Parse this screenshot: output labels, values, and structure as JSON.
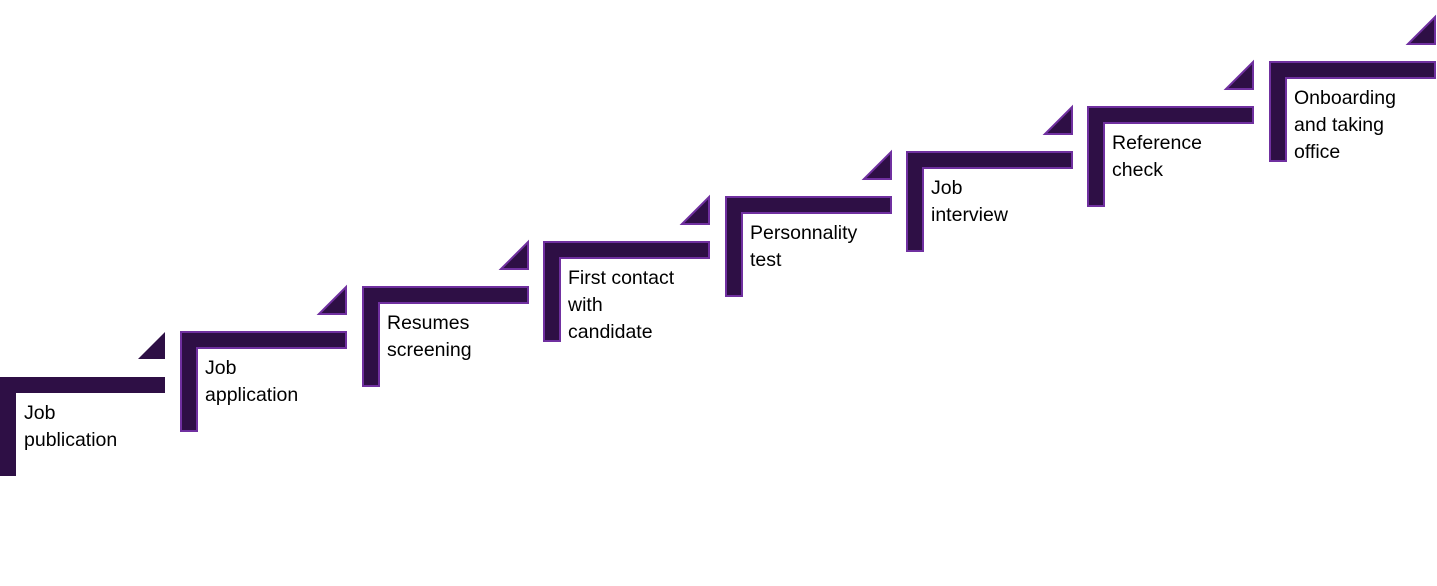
{
  "colors": {
    "fill": "#2e0f45",
    "outline": "#7030a0",
    "text": "#000000"
  },
  "steps": [
    {
      "label": "Job\npublication"
    },
    {
      "label": "Job\napplication"
    },
    {
      "label": "Resumes\nscreening"
    },
    {
      "label": "First contact\nwith\ncandidate"
    },
    {
      "label": "Personnality\ntest"
    },
    {
      "label": "Job\ninterview"
    },
    {
      "label": "Reference\ncheck"
    },
    {
      "label": "Onboarding\nand taking\noffice"
    }
  ]
}
